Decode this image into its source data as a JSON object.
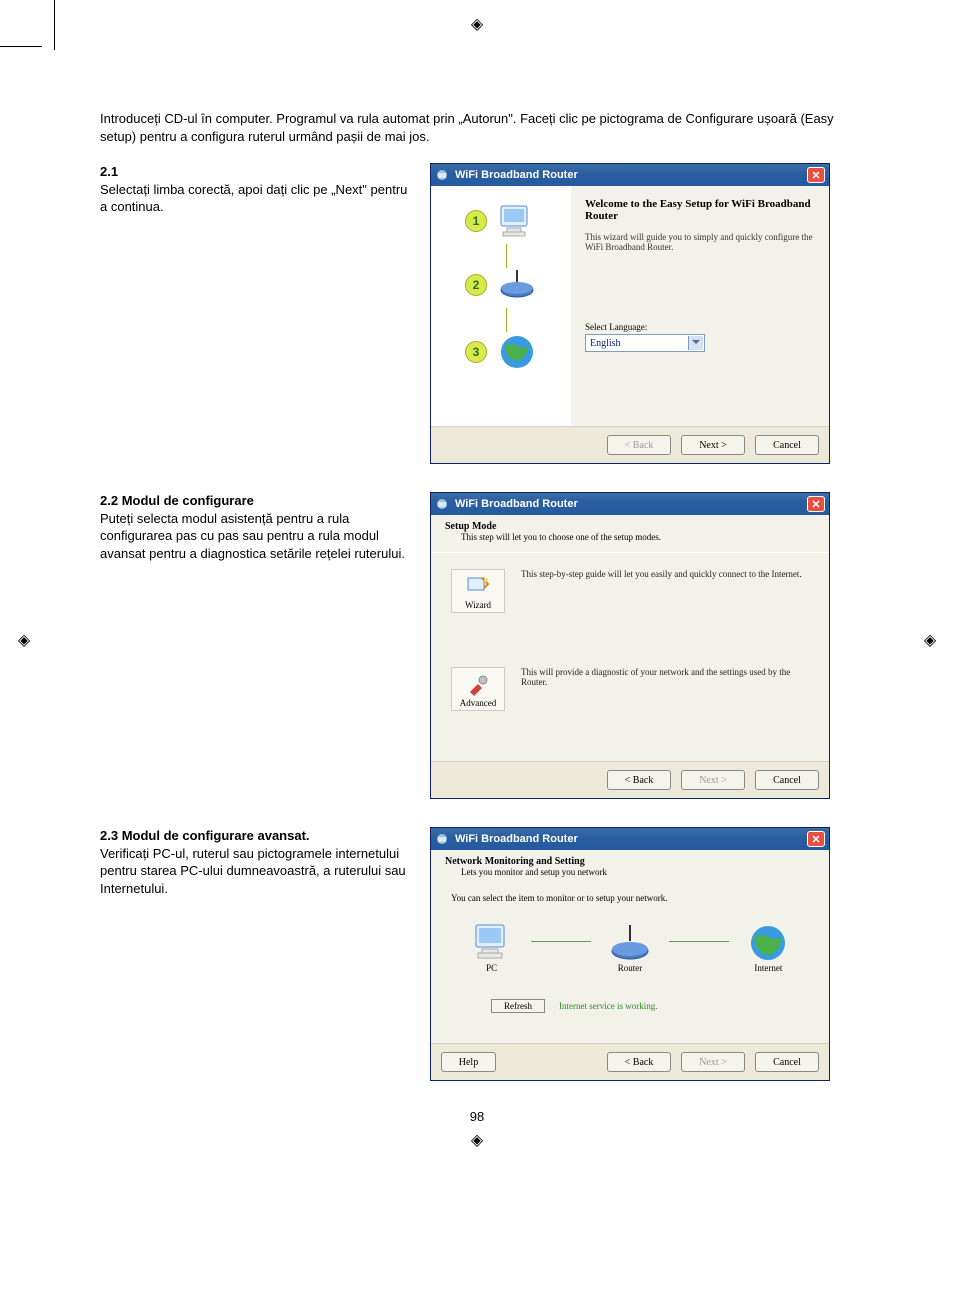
{
  "intro": "Introduceți CD-ul în computer. Programul va rula automat prin „Autorun\". Faceți clic pe pictograma de Configurare ușoară (Easy setup) pentru a configura ruterul urmând pașii de mai jos.",
  "sections": {
    "s1": {
      "num": "2.1",
      "body": "Selectați limba corectă, apoi dați clic pe „Next\" pentru a continua."
    },
    "s2": {
      "num": "2.2",
      "title": "Modul de configurare",
      "body": "Puteți selecta modul asistență pentru a rula configurarea pas cu pas sau pentru a rula modul avansat pentru a diagnostica setările rețelei ruterului."
    },
    "s3": {
      "num": "2.3",
      "title": "Modul de configurare avansat.",
      "body": "Verificați PC-ul, ruterul sau pictogramele internetului pentru starea PC-ului dumneavoastră, a ruterului sau Internetului."
    }
  },
  "win1": {
    "title": "WiFi Broadband Router",
    "welcome_title": "Welcome to the Easy Setup for WiFi Broadband Router",
    "welcome_sub": "This wizard will guide you to simply and quickly configure the WiFi Broadband Router.",
    "select_language_label": "Select Language:",
    "language_value": "English",
    "steps": {
      "n1": "1",
      "n2": "2",
      "n3": "3"
    },
    "buttons": {
      "back": "< Back",
      "next": "Next >",
      "cancel": "Cancel"
    }
  },
  "win2": {
    "title": "WiFi Broadband Router",
    "header_title": "Setup Mode",
    "header_sub": "This step will let you to choose one of the setup modes.",
    "wizard": {
      "label": "Wizard",
      "desc": "This step-by-step guide will let you easily and quickly connect to the Internet."
    },
    "advanced": {
      "label": "Advanced",
      "desc": "This will provide a diagnostic of your network and the settings used by the Router."
    },
    "buttons": {
      "back": "< Back",
      "next": "Next >",
      "cancel": "Cancel"
    }
  },
  "win3": {
    "title": "WiFi Broadband Router",
    "header_title": "Network Monitoring and Setting",
    "header_sub": "Lets you monitor and setup you network",
    "instruction": "You can select the item to monitor or to setup your network.",
    "items": {
      "pc": "PC",
      "router": "Router",
      "internet": "Internet"
    },
    "refresh": "Refresh",
    "status": "Internet service is working.",
    "buttons": {
      "help": "Help",
      "back": "< Back",
      "next": "Next >",
      "cancel": "Cancel"
    }
  },
  "page_number": "98"
}
